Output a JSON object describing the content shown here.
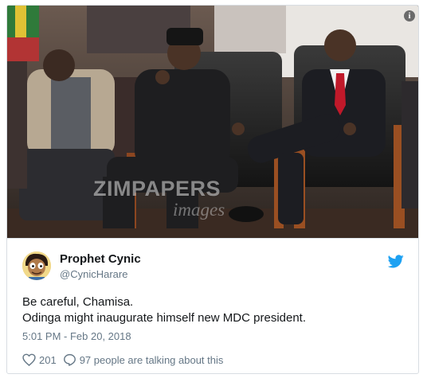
{
  "media": {
    "watermark": "ZIMPAPERS",
    "watermark_sub": "images",
    "info_glyph": "i"
  },
  "tweet": {
    "author_name": "Prophet Cynic",
    "author_handle": "@CynicHarare",
    "avatar_icon": "cartoon-avatar",
    "text_line1": "Be careful, Chamisa.",
    "text_line2": "Odinga might inaugurate himself new MDC president.",
    "timestamp": "5:01 PM - Feb 20, 2018",
    "likes": "201",
    "replies_text": "97 people are talking about this"
  },
  "colors": {
    "twitter_blue": "#1da1f2",
    "secondary_text": "#657786",
    "primary_text": "#14171a"
  }
}
